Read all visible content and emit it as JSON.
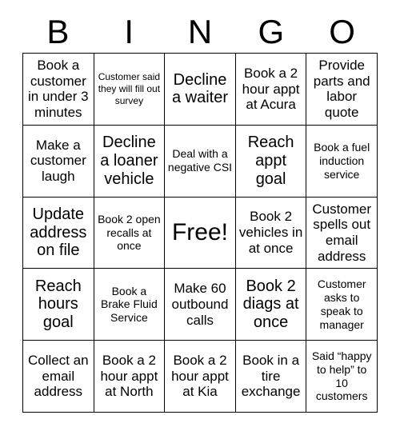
{
  "card": {
    "header_letters": [
      "B",
      "I",
      "N",
      "G",
      "O"
    ],
    "columns": 5,
    "rows": 5,
    "free_space": "Free!",
    "free_space_position": {
      "row": 3,
      "column": 3
    },
    "colors": {
      "background": "#ffffff",
      "border": "#000000",
      "text": "#000000"
    },
    "squares": [
      [
        {
          "text": "Book a customer in under 3 minutes",
          "size": "md"
        },
        {
          "text": "Customer said they will fill out survey",
          "size": "xs"
        },
        {
          "text": "Decline a waiter",
          "size": "lg"
        },
        {
          "text": "Book a 2 hour appt at Acura",
          "size": "md"
        },
        {
          "text": "Provide parts and labor quote",
          "size": "md"
        }
      ],
      [
        {
          "text": "Make a customer laugh",
          "size": "md"
        },
        {
          "text": "Decline a loaner vehicle",
          "size": "lg"
        },
        {
          "text": "Deal with a negative CSI",
          "size": "sm"
        },
        {
          "text": "Reach appt goal",
          "size": "lg"
        },
        {
          "text": "Book a fuel induction service",
          "size": "sm"
        }
      ],
      [
        {
          "text": "Update address on file",
          "size": "lg"
        },
        {
          "text": "Book 2 open recalls at once",
          "size": "sm"
        },
        {
          "text": "Free!",
          "size": "xl"
        },
        {
          "text": "Book 2 vehicles in at once",
          "size": "md"
        },
        {
          "text": "Customer spells out email address",
          "size": "md"
        }
      ],
      [
        {
          "text": "Reach hours goal",
          "size": "lg"
        },
        {
          "text": "Book a Brake Fluid Service",
          "size": "sm"
        },
        {
          "text": "Make 60 outbound calls",
          "size": "md"
        },
        {
          "text": "Book 2 diags at once",
          "size": "lg"
        },
        {
          "text": "Customer asks to speak to manager",
          "size": "sm"
        }
      ],
      [
        {
          "text": "Collect an email address",
          "size": "md"
        },
        {
          "text": "Book a 2 hour appt at North",
          "size": "md"
        },
        {
          "text": "Book a 2 hour appt at Kia",
          "size": "md"
        },
        {
          "text": "Book in a tire exchange",
          "size": "md"
        },
        {
          "text": "Said “happy to help” to 10 customers",
          "size": "sm"
        }
      ]
    ]
  }
}
